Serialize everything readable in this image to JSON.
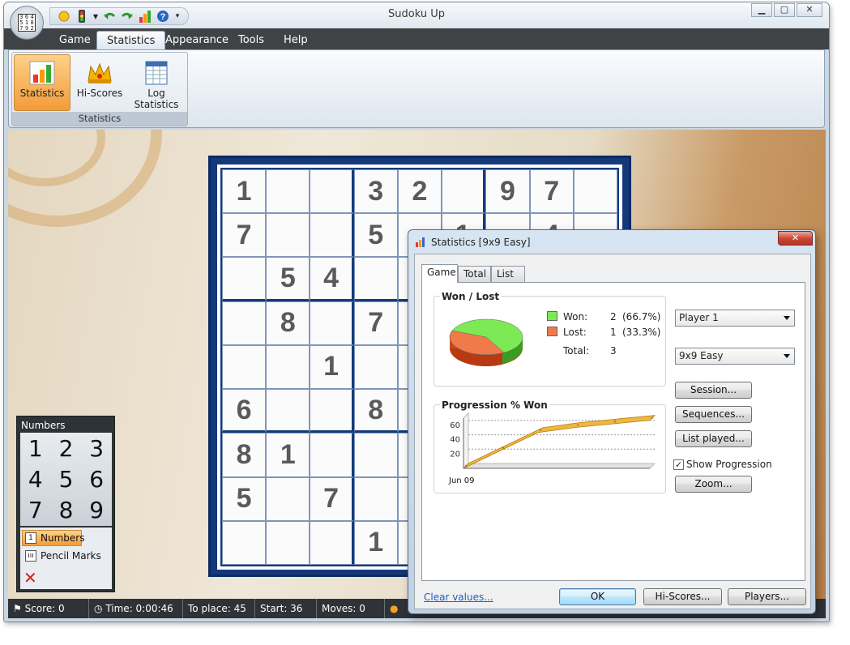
{
  "window": {
    "title": "Sudoku Up"
  },
  "quick_access": {
    "icons": [
      "sun-icon",
      "traffic-light-icon",
      "undo-arrow-icon",
      "redo-arrow-icon",
      "bar-chart-icon",
      "help-icon",
      "customize-dropdown-icon"
    ],
    "help_glyph": "?"
  },
  "menu_tabs": [
    {
      "label": "Game"
    },
    {
      "label": "Statistics",
      "active": true
    },
    {
      "label": "Appearance"
    },
    {
      "label": "Tools"
    },
    {
      "label": "Help"
    }
  ],
  "ribbon": {
    "buttons": [
      {
        "label": "Statistics",
        "icon": "bar-chart-icon",
        "selected": true
      },
      {
        "label": "Hi-Scores",
        "icon": "crown-icon"
      },
      {
        "label": "Log Statistics",
        "icon": "table-icon"
      }
    ],
    "group_label": "Statistics"
  },
  "board": {
    "cells": [
      [
        "1",
        "",
        "",
        "3",
        "2",
        "",
        "9",
        "7",
        ""
      ],
      [
        "7",
        "",
        "",
        "5",
        "",
        "1",
        "",
        "4",
        ""
      ],
      [
        "",
        "5",
        "4",
        "",
        "",
        "",
        "",
        "",
        ""
      ],
      [
        "",
        "8",
        "",
        "7",
        "",
        "",
        "",
        "",
        ""
      ],
      [
        "",
        "",
        "1",
        "",
        "",
        "",
        "",
        "",
        ""
      ],
      [
        "6",
        "",
        "",
        "8",
        "",
        "",
        "",
        "",
        ""
      ],
      [
        "8",
        "1",
        "",
        "",
        "",
        "",
        "",
        "",
        ""
      ],
      [
        "5",
        "",
        "7",
        "",
        "",
        "",
        "",
        "",
        ""
      ],
      [
        "",
        "",
        "",
        "1",
        "",
        "",
        "",
        "",
        ""
      ]
    ]
  },
  "numbers_panel": {
    "title": "Numbers",
    "keys": [
      "1",
      "2",
      "3",
      "4",
      "5",
      "6",
      "7",
      "8",
      "9"
    ],
    "options": [
      {
        "label": "Numbers",
        "glyph": "1",
        "selected": true
      },
      {
        "label": "Pencil Marks",
        "glyph": "ııı"
      }
    ],
    "clear_glyph": "✕"
  },
  "status_bar": {
    "score": "Score: 0",
    "time": "Time: 0:00:46",
    "to_place": "To place: 45",
    "start": "Start: 36",
    "moves": "Moves: 0"
  },
  "dialog": {
    "title": "Statistics [9x9 Easy]",
    "close_glyph": "✕",
    "tabs": [
      {
        "label": "Game",
        "active": true
      },
      {
        "label": "Total"
      },
      {
        "label": "List"
      }
    ],
    "won_lost": {
      "title": "Won / Lost",
      "won_label": "Won:",
      "won_count": "2",
      "won_pct": "(66.7%)",
      "lost_label": "Lost:",
      "lost_count": "1",
      "lost_pct": "(33.3%)",
      "total_label": "Total:",
      "total_count": "3",
      "won_color": "#7dea55",
      "lost_color": "#f07a4a"
    },
    "progression": {
      "title": "Progression % Won",
      "x_label": "Jun 09",
      "y_ticks": [
        "20",
        "40",
        "60"
      ]
    },
    "player_select": "Player 1",
    "difficulty_select": "9x9 Easy",
    "buttons": {
      "session": "Session...",
      "sequences": "Sequences...",
      "list_played": "List played...",
      "zoom": "Zoom...",
      "ok": "OK",
      "hi_scores": "Hi-Scores...",
      "players": "Players..."
    },
    "show_progression": {
      "label": "Show Progression",
      "checked": true
    },
    "clear_values": "Clear values..."
  },
  "chart_data": {
    "type": "area",
    "title": "Progression % Won",
    "x": [
      "Jun 09"
    ],
    "series": [
      {
        "values": [
          0,
          25,
          50,
          57,
          62,
          67
        ]
      }
    ],
    "ylim": [
      0,
      70
    ],
    "y_ticks": [
      20,
      40,
      60
    ],
    "grid": true,
    "color": "#f2b640"
  }
}
